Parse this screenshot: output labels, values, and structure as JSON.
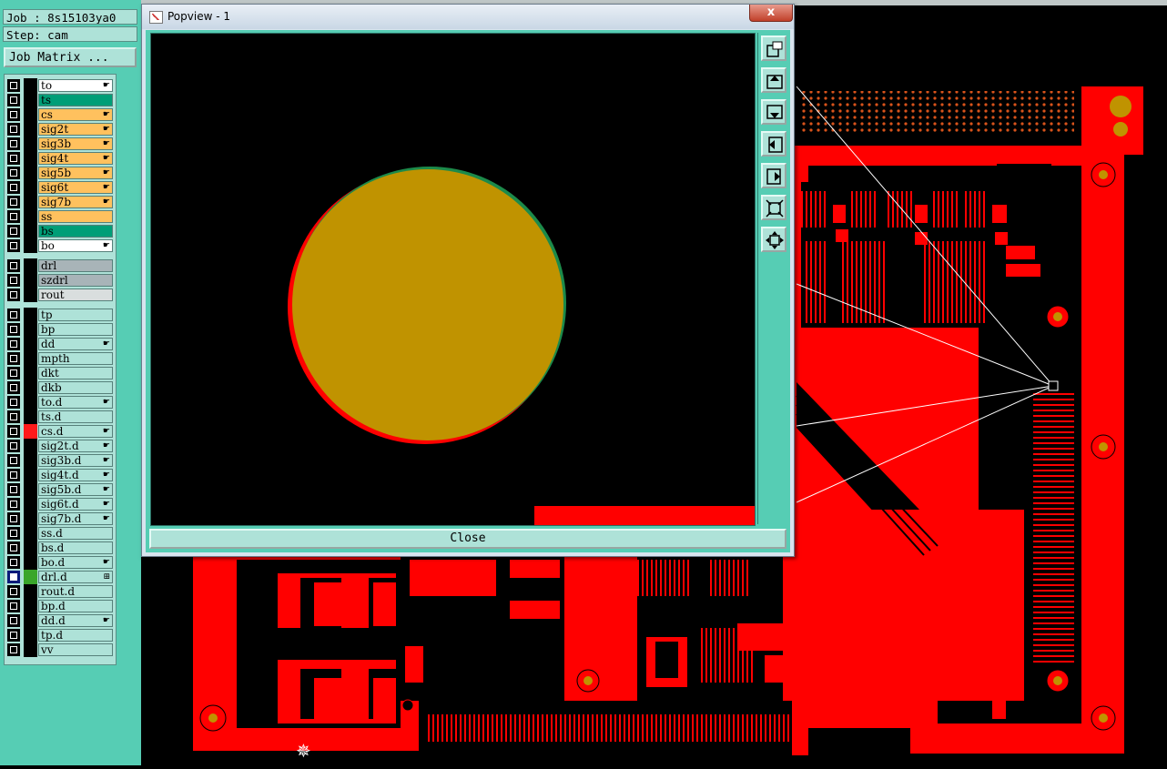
{
  "job": {
    "job_text": "Job : 8s15103ya0",
    "step_text": "Step: cam"
  },
  "job_matrix_label": "Job Matrix ...",
  "colors": {
    "red": "#ff0000",
    "pad": "#c09300",
    "panel": "#56cdb4",
    "cyan": "#aee2d8",
    "orange": "#ffc15e",
    "green": "#009e77",
    "grey": "#a8b4b8"
  },
  "layers": [
    {
      "name": "to",
      "color": "#ffffff",
      "mark": "☛"
    },
    {
      "name": "ts",
      "color": "#009e77",
      "mark": ""
    },
    {
      "name": "cs",
      "color": "#ffc15e",
      "mark": "☛"
    },
    {
      "name": "sig2t",
      "color": "#ffc15e",
      "mark": "☛"
    },
    {
      "name": "sig3b",
      "color": "#ffc15e",
      "mark": "☛"
    },
    {
      "name": "sig4t",
      "color": "#ffc15e",
      "mark": "☛"
    },
    {
      "name": "sig5b",
      "color": "#ffc15e",
      "mark": "☛"
    },
    {
      "name": "sig6t",
      "color": "#ffc15e",
      "mark": "☛"
    },
    {
      "name": "sig7b",
      "color": "#ffc15e",
      "mark": "☛"
    },
    {
      "name": "ss",
      "color": "#ffc15e",
      "mark": ""
    },
    {
      "name": "bs",
      "color": "#009e77",
      "mark": ""
    },
    {
      "name": "bo",
      "color": "#ffffff",
      "mark": "☛"
    },
    {
      "name": "drl",
      "color": "#a8b4b8",
      "mark": ""
    },
    {
      "name": "szdrl",
      "color": "#a8b4b8",
      "mark": ""
    },
    {
      "name": "rout",
      "color": "#d9dede",
      "mark": ""
    },
    {
      "name": "tp",
      "color": "#aee2d8",
      "mark": ""
    },
    {
      "name": "bp",
      "color": "#aee2d8",
      "mark": ""
    },
    {
      "name": "dd",
      "color": "#aee2d8",
      "mark": "☛"
    },
    {
      "name": "mpth",
      "color": "#aee2d8",
      "mark": ""
    },
    {
      "name": "dkt",
      "color": "#aee2d8",
      "mark": ""
    },
    {
      "name": "dkb",
      "color": "#aee2d8",
      "mark": ""
    },
    {
      "name": "to.d",
      "color": "#aee2d8",
      "mark": "☛"
    },
    {
      "name": "ts.d",
      "color": "#aee2d8",
      "mark": ""
    },
    {
      "name": "cs.d",
      "color": "#aee2d8",
      "mark": "☛",
      "indicator": "#ff1a1a"
    },
    {
      "name": "sig2t.d",
      "color": "#aee2d8",
      "mark": "☛"
    },
    {
      "name": "sig3b.d",
      "color": "#aee2d8",
      "mark": "☛"
    },
    {
      "name": "sig4t.d",
      "color": "#aee2d8",
      "mark": "☛"
    },
    {
      "name": "sig5b.d",
      "color": "#aee2d8",
      "mark": "☛"
    },
    {
      "name": "sig6t.d",
      "color": "#aee2d8",
      "mark": "☛"
    },
    {
      "name": "sig7b.d",
      "color": "#aee2d8",
      "mark": "☛"
    },
    {
      "name": "ss.d",
      "color": "#aee2d8",
      "mark": ""
    },
    {
      "name": "bs.d",
      "color": "#aee2d8",
      "mark": ""
    },
    {
      "name": "bo.d",
      "color": "#aee2d8",
      "mark": "☛"
    },
    {
      "name": "drl.d",
      "color": "#aee2d8",
      "mark": "⊞",
      "indicator": "#3aa62a",
      "selected": true
    },
    {
      "name": "rout.d",
      "color": "#aee2d8",
      "mark": ""
    },
    {
      "name": "bp.d",
      "color": "#aee2d8",
      "mark": ""
    },
    {
      "name": "dd.d",
      "color": "#aee2d8",
      "mark": "☛"
    },
    {
      "name": "tp.d",
      "color": "#aee2d8",
      "mark": ""
    },
    {
      "name": "vv",
      "color": "#aee2d8",
      "mark": ""
    }
  ],
  "popview": {
    "title": "Popview - 1",
    "close_x": "x",
    "close_button": "Close",
    "toolbar_icons": [
      "zoom-window-icon",
      "pan-up-icon",
      "pan-down-icon",
      "pan-left-icon",
      "pan-right-icon",
      "zoom-fit-icon",
      "zoom-center-icon"
    ]
  },
  "compass_icon": "compass-icon"
}
